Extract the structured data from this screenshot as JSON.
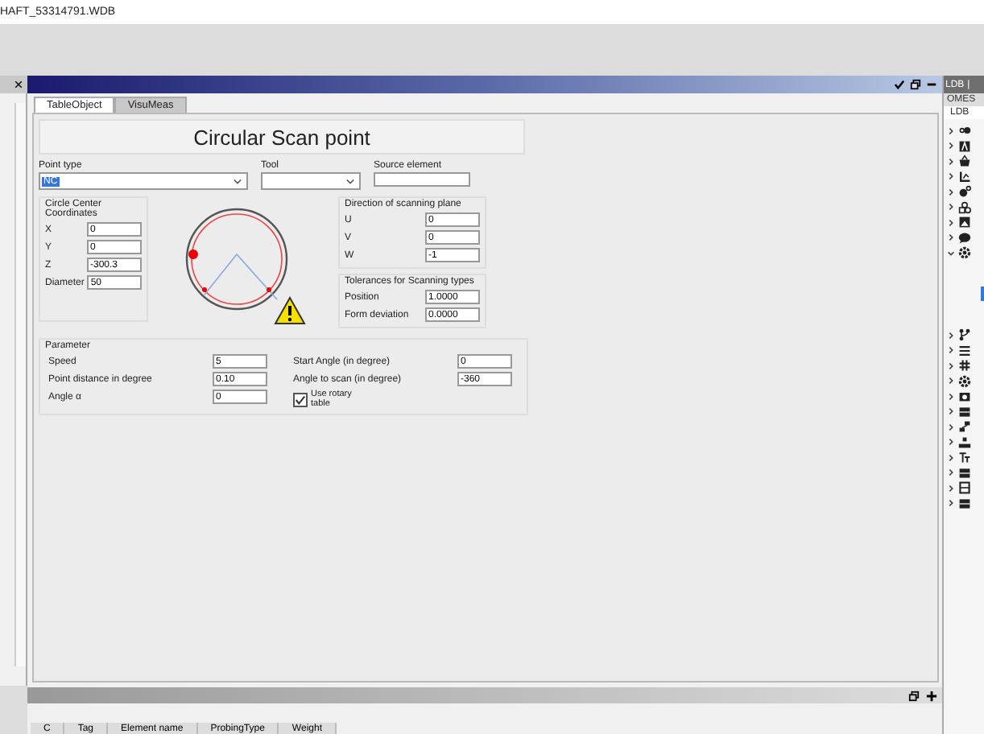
{
  "window": {
    "title": "HAFT_53314791.WDB"
  },
  "right_panel": {
    "tabs": [
      "LDB",
      "|"
    ],
    "subtab_top": "OMES",
    "subtab": "LDB",
    "tree": [
      {
        "kind": "toggle",
        "expanded": false
      },
      {
        "kind": "letter",
        "expanded": false
      },
      {
        "kind": "basket",
        "expanded": false
      },
      {
        "kind": "axes",
        "expanded": false
      },
      {
        "kind": "gears",
        "expanded": false
      },
      {
        "kind": "shapes",
        "expanded": false
      },
      {
        "kind": "image",
        "expanded": false
      },
      {
        "kind": "chat",
        "expanded": false
      },
      {
        "kind": "gear",
        "expanded": true
      }
    ],
    "tree2": [
      {
        "kind": "branch",
        "expanded": false
      },
      {
        "kind": "list",
        "expanded": false
      },
      {
        "kind": "hash",
        "expanded": false
      },
      {
        "kind": "gear",
        "expanded": false
      },
      {
        "kind": "camera",
        "expanded": false
      },
      {
        "kind": "film",
        "expanded": false
      },
      {
        "kind": "link",
        "expanded": false
      },
      {
        "kind": "sitemap",
        "expanded": false
      },
      {
        "kind": "text",
        "expanded": false
      },
      {
        "kind": "film",
        "expanded": false
      },
      {
        "kind": "box",
        "expanded": false
      },
      {
        "kind": "film",
        "expanded": false
      }
    ]
  },
  "tabs": [
    {
      "label": "TableObject",
      "selected": true
    },
    {
      "label": "VisuMeas",
      "selected": false
    }
  ],
  "form": {
    "title": "Circular Scan  point",
    "point_type": {
      "label": "Point type",
      "value": "NC"
    },
    "tool": {
      "label": "Tool"
    },
    "source": {
      "label": "Source element"
    },
    "center": {
      "label": "Circle Center Coordinates",
      "rows": [
        {
          "label": "X",
          "value": "0"
        },
        {
          "label": "Y",
          "value": "0"
        },
        {
          "label": "Z",
          "value": "-300.3"
        },
        {
          "label": "Diameter",
          "value": "50"
        }
      ]
    },
    "direction": {
      "label": "Direction of scanning plane",
      "rows": [
        {
          "label": "U",
          "value": "0"
        },
        {
          "label": "V",
          "value": "0"
        },
        {
          "label": "W",
          "value": "-1"
        }
      ]
    },
    "tolerances": {
      "label": "Tolerances for Scanning types",
      "rows": [
        {
          "label": "Position",
          "value": "1.0000"
        },
        {
          "label": "Form deviation",
          "value": "0.0000"
        }
      ]
    },
    "parameter": {
      "label": "Parameter",
      "left": [
        {
          "label": "Speed",
          "value": "5"
        },
        {
          "label": "Point distance in degree",
          "value": "0.10"
        },
        {
          "label": "Angle α",
          "value": "0"
        }
      ],
      "right": [
        {
          "label": "Start Angle (in degree)",
          "value": "0"
        },
        {
          "label": "Angle to scan (in degree)",
          "value": "-360"
        }
      ],
      "rotary": {
        "label": "Use rotary table",
        "checked": true
      }
    }
  },
  "bottom": {
    "columns": [
      "C",
      "Tag",
      "Element name",
      "ProbingType",
      "Weight"
    ]
  }
}
